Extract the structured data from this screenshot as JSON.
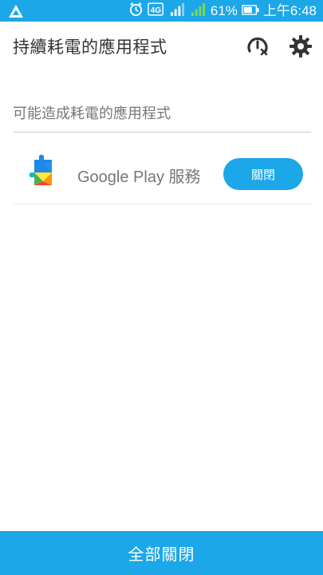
{
  "status_bar": {
    "battery_percent": "61%",
    "time": "上午6:48",
    "network_badge": "4G",
    "icons": [
      "asus-logo-icon",
      "alarm-icon",
      "4g-icon",
      "signal-icon-1",
      "signal-icon-2",
      "battery-icon"
    ]
  },
  "header": {
    "title": "持續耗電的應用程式",
    "icons": [
      "speed-boost-icon",
      "gear-icon"
    ]
  },
  "section": {
    "title": "可能造成耗電的應用程式"
  },
  "apps": [
    {
      "name": "Google Play 服務",
      "action_label": "關閉",
      "icon": "google-play-services-icon"
    }
  ],
  "bottom_bar": {
    "label": "全部關閉"
  },
  "colors": {
    "accent": "#1ba7e8",
    "title_text": "#333333",
    "secondary_text": "#777777",
    "divider": "#cfcfcf"
  }
}
